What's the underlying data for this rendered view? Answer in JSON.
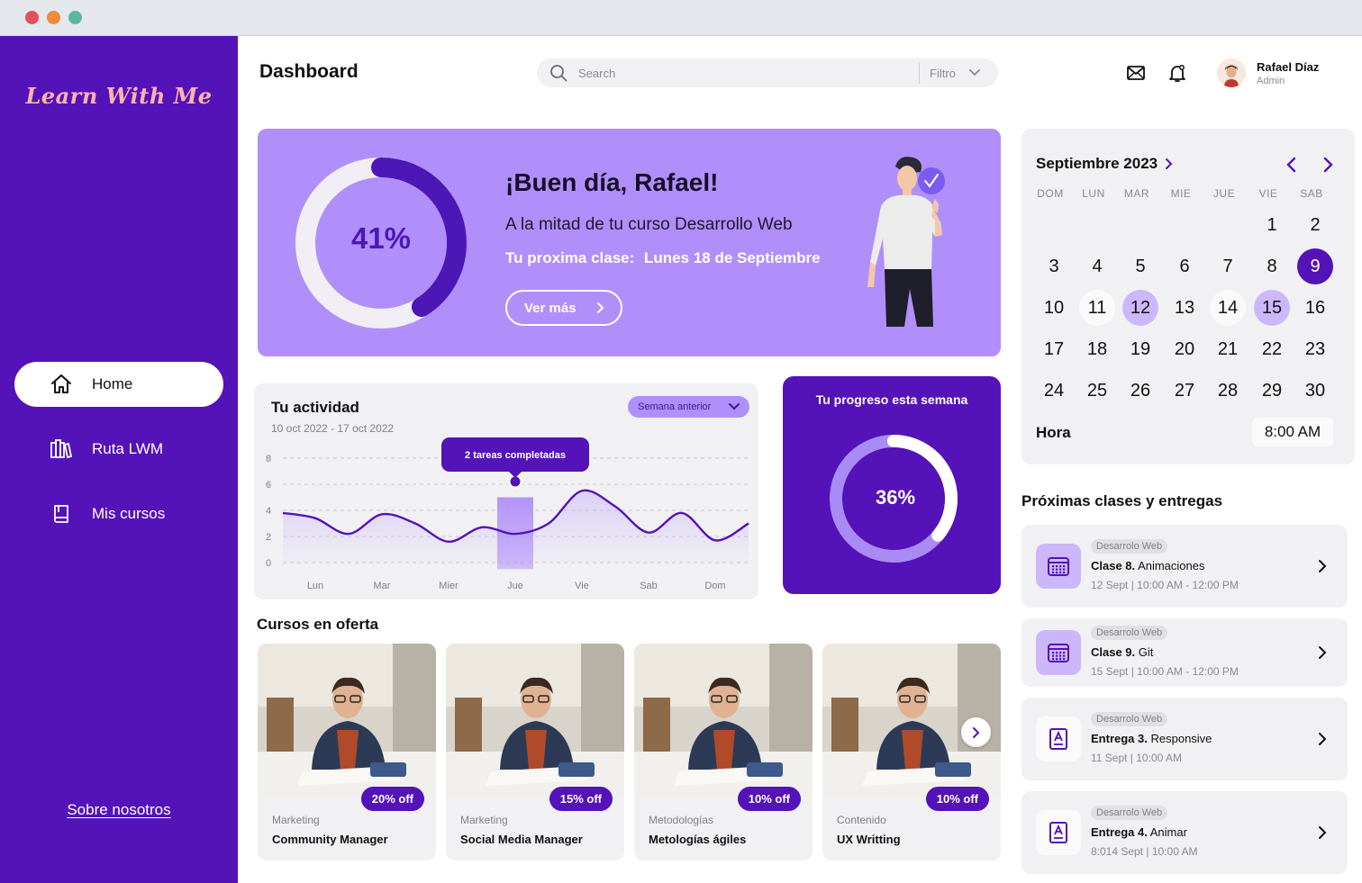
{
  "window": {
    "dots": [
      "#e0525e",
      "#ee8a3c",
      "#5bb8a0"
    ]
  },
  "colors": {
    "primary": "#5412b9",
    "lavender": "#b18ffa",
    "light_lavender": "#cdb7fb",
    "logo": "#ffb3ad"
  },
  "sidebar": {
    "logo": "Learn With Me",
    "items": [
      {
        "label": "Home",
        "icon": "home-icon",
        "active": true
      },
      {
        "label": "Ruta LWM",
        "icon": "books-icon",
        "active": false
      },
      {
        "label": "Mis cursos",
        "icon": "book-icon",
        "active": false
      }
    ],
    "about": "Sobre nosotros"
  },
  "header": {
    "title": "Dashboard",
    "search_placeholder": "Search",
    "filter_label": "Filtro",
    "user_name": "Rafael Díaz",
    "user_role": "Admin"
  },
  "hero": {
    "percent_text": "41%",
    "percent": 0.41,
    "greeting": "¡Buen día, Rafael!",
    "subtitle": "A la mitad de tu curso Desarrollo Web",
    "next_label": "Tu proxima clase:",
    "next_value": "Lunes 18 de Septiembre",
    "button": "Ver más"
  },
  "activity": {
    "title": "Tu actividad",
    "range": "10 oct 2022 - 17 oct 2022",
    "select": "Semana anterior",
    "tooltip": "2 tareas completadas"
  },
  "chart_data": {
    "type": "line",
    "categories": [
      "Lun",
      "Mar",
      "Mier",
      "Jue",
      "Vie",
      "Sab",
      "Dom"
    ],
    "y_ticks": [
      0,
      2,
      4,
      6,
      8
    ],
    "ylim": [
      0,
      8
    ],
    "x": [
      -0.5,
      0,
      0.5,
      1,
      1.5,
      2,
      2.5,
      3,
      3.5,
      4,
      4.5,
      5,
      5.5,
      6,
      6.5
    ],
    "values": [
      3.8,
      3.4,
      2.2,
      3.7,
      3.0,
      1.6,
      2.7,
      2.2,
      3.0,
      5.5,
      4.3,
      2.3,
      3.8,
      1.7,
      3.0
    ],
    "highlight_category": "Jue",
    "highlight_point": {
      "x": 3,
      "y": 6
    },
    "grid": true
  },
  "progress": {
    "title": "Tu progreso esta semana",
    "percent_text": "36%",
    "percent": 0.36
  },
  "courses": {
    "title": "Cursos en oferta",
    "items": [
      {
        "category": "Marketing",
        "name": "Community Manager",
        "badge": "20% off"
      },
      {
        "category": "Marketing",
        "name": "Social Media Manager",
        "badge": "15% off"
      },
      {
        "category": "Metodologías",
        "name": "Metologías ágiles",
        "badge": "10% off"
      },
      {
        "category": "Contenido",
        "name": "UX Writting",
        "badge": "10% off"
      }
    ]
  },
  "calendar": {
    "month": "Septiembre 2023",
    "days_of_week": [
      "DOM",
      "LUN",
      "MAR",
      "MIE",
      "JUE",
      "VIE",
      "SAB"
    ],
    "first_weekday": 5,
    "num_days": 30,
    "selected": 9,
    "highlighted": [
      12,
      15
    ],
    "soft": [
      11,
      14
    ],
    "hora_label": "Hora",
    "hora_value": "8:00 AM"
  },
  "upcoming": {
    "title": "Próximas clases y entregas",
    "items": [
      {
        "tag": "Desarrolo Web",
        "bold": "Clase 8.",
        "name": "Animaciones",
        "time": "12 Sept | 10:00 AM - 12:00 PM",
        "icon": "calendar-icon"
      },
      {
        "tag": "Desarrolo Web",
        "bold": "Clase 9.",
        "name": "Git",
        "time": "15 Sept | 10:00 AM - 12:00 PM",
        "icon": "calendar-icon"
      },
      {
        "tag": "Desarrolo Web",
        "bold": "Entrega 3.",
        "name": "Responsive",
        "time": "11 Sept | 10:00 AM",
        "icon": "assignment-icon"
      },
      {
        "tag": "Desarrolo Web",
        "bold": "Entrega 4.",
        "name": "Animar",
        "time": "8:014 Sept | 10:00 AM",
        "icon": "assignment-icon"
      }
    ]
  }
}
